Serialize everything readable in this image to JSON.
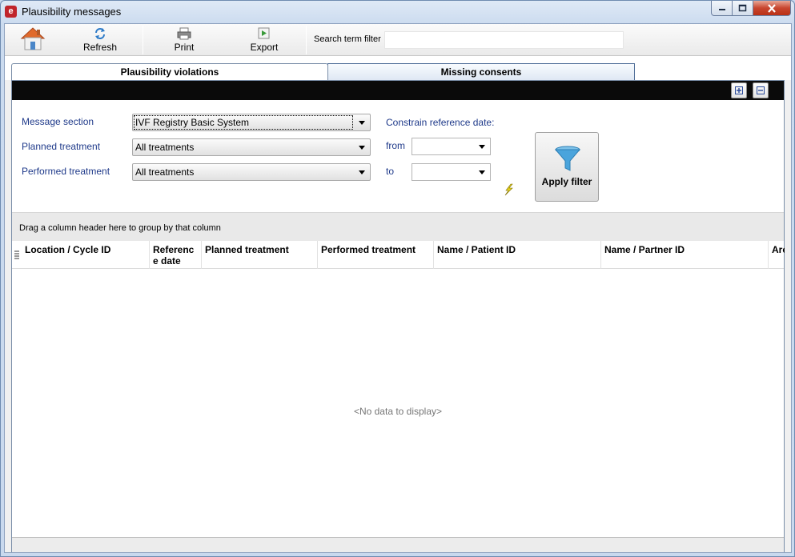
{
  "window": {
    "title": "Plausibility messages",
    "app_icon_glyph": "e"
  },
  "toolbar": {
    "home_icon": "home-icon",
    "refresh_label": "Refresh",
    "print_label": "Print",
    "export_label": "Export",
    "search_label": "Search term filter",
    "search_value": ""
  },
  "tabs": [
    {
      "label": "Plausibility violations",
      "active": true
    },
    {
      "label": "Missing consents",
      "active": false
    }
  ],
  "filters": {
    "message_section_label": "Message section",
    "message_section_value": "IVF Registry Basic System",
    "planned_treatment_label": "Planned treatment",
    "planned_treatment_value": "All treatments",
    "performed_treatment_label": "Performed treatment",
    "performed_treatment_value": "All treatments",
    "constrain_label": "Constrain reference date:",
    "from_label": "from",
    "to_label": "to",
    "from_value": "",
    "to_value": "",
    "apply_label": "Apply filter"
  },
  "grid": {
    "group_hint": "Drag a column header here to group by that column",
    "columns": [
      "Location / Cycle ID",
      "Referenc e date",
      "Planned treatment",
      "Performed treatment",
      "Name / Patient ID",
      "Name / Partner ID",
      "Are"
    ],
    "empty_text": "<No data to display>"
  },
  "colors": {
    "label_blue": "#1f3a8a",
    "tab_bar_black": "#0a0a0a",
    "close_red": "#c8462f"
  }
}
